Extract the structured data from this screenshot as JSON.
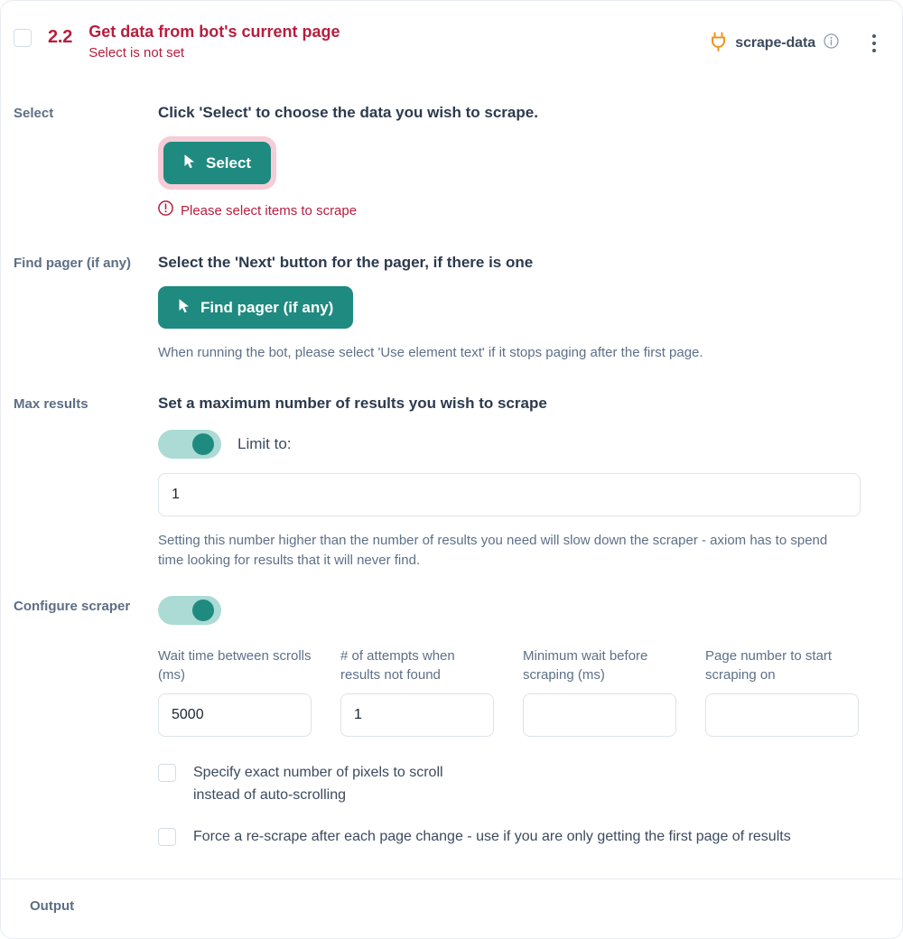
{
  "header": {
    "step_number": "2.2",
    "title": "Get data from bot's current page",
    "subtitle": "Select is not set",
    "integration_name": "scrape-data",
    "plug_icon": "plug-icon",
    "info_icon": "info-icon",
    "menu_icon": "kebab-menu-icon",
    "checkbox_icon": "step-checkbox",
    "title_color": "#b81d3e",
    "accent_color": "#1f8a80"
  },
  "select_section": {
    "label": "Select",
    "heading": "Click 'Select' to choose the data you wish to scrape.",
    "button_label": "Select",
    "button_icon": "cursor-arrow-icon",
    "error_icon": "alert-circle-icon",
    "error_text": "Please select items to scrape",
    "highlight_color": "#f6ccd6"
  },
  "pager_section": {
    "label": "Find pager (if any)",
    "heading": "Select the 'Next' button for the pager, if there is one",
    "button_label": "Find pager (if any)",
    "button_icon": "cursor-arrow-icon",
    "helper_text": "When running the bot, please select 'Use element text' if it stops paging after the first page."
  },
  "max_results_section": {
    "label": "Max results",
    "heading": "Set a maximum number of results you wish to scrape",
    "toggle_on": true,
    "toggle_label": "Limit to:",
    "limit_value": "1",
    "limit_placeholder": "",
    "helper_text": "Setting this number higher than the number of results you need will slow down the scraper - axiom has to spend time looking for results that it will never find."
  },
  "configure_section": {
    "label": "Configure scraper",
    "toggle_on": true,
    "fields": [
      {
        "label": "Wait time between scrolls (ms)",
        "value": "5000",
        "placeholder": ""
      },
      {
        "label": "# of attempts when results not found",
        "value": "1",
        "placeholder": ""
      },
      {
        "label": "Minimum wait before scraping (ms)",
        "value": "",
        "placeholder": ""
      },
      {
        "label": "Page number to start scraping on",
        "value": "",
        "placeholder": ""
      }
    ],
    "options": [
      {
        "label": "Specify exact number of pixels to scroll instead of auto-scrolling",
        "checked": false
      },
      {
        "label": "Force a re-scrape after each page change - use if you are only getting the first page of results",
        "checked": false
      }
    ]
  },
  "output_section": {
    "label": "Output"
  }
}
